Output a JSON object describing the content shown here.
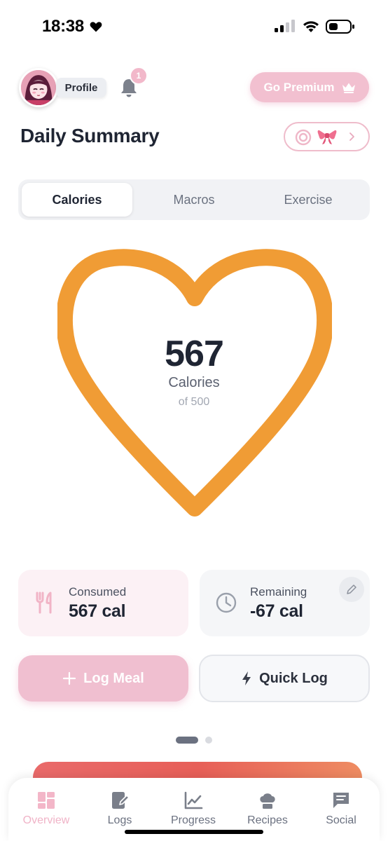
{
  "status_bar": {
    "time": "18:38"
  },
  "header": {
    "profile_label": "Profile",
    "notification_count": "1",
    "premium_label": "Go Premium"
  },
  "page_title": "Daily Summary",
  "tabs": [
    {
      "label": "Calories",
      "active": true
    },
    {
      "label": "Macros",
      "active": false
    },
    {
      "label": "Exercise",
      "active": false
    }
  ],
  "calorie_ring": {
    "value": "567",
    "unit_label": "Calories",
    "goal_text": "of 500",
    "progress": 1.0,
    "ring_color": "#F09C35"
  },
  "stats": {
    "consumed": {
      "label": "Consumed",
      "value": "567 cal"
    },
    "remaining": {
      "label": "Remaining",
      "value": "-67 cal"
    }
  },
  "actions": {
    "log_meal_label": "Log Meal",
    "quick_log_label": "Quick Log"
  },
  "pager": {
    "pages": 2,
    "current": 1
  },
  "nav": [
    {
      "label": "Overview",
      "icon": "overview-icon",
      "active": true
    },
    {
      "label": "Logs",
      "icon": "logs-icon",
      "active": false
    },
    {
      "label": "Progress",
      "icon": "progress-icon",
      "active": false
    },
    {
      "label": "Recipes",
      "icon": "recipes-icon",
      "active": false
    },
    {
      "label": "Social",
      "icon": "social-icon",
      "active": false
    }
  ],
  "colors": {
    "accent_pink": "#F2C0D0",
    "ring_orange": "#F09C35",
    "text_dark": "#1F2533"
  }
}
